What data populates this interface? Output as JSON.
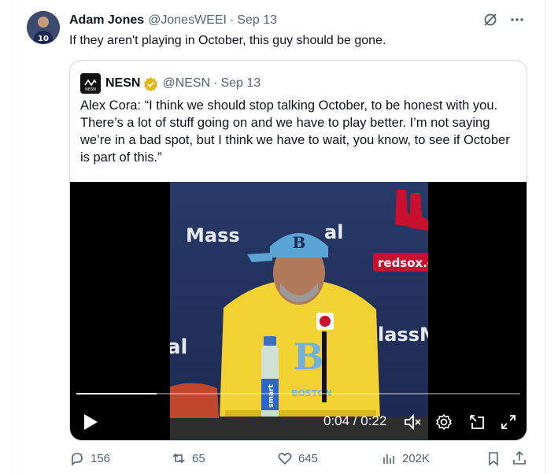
{
  "tweet": {
    "author_name": "Adam Jones",
    "author_handle": "@JonesWEEI",
    "separator": "·",
    "timestamp": "Sep 13",
    "text": "If they aren't playing in October, this guy should be gone.",
    "avatar_jersey": "10"
  },
  "quoted": {
    "author_name": "NESN",
    "author_handle": "@NESN",
    "separator": "·",
    "timestamp": "Sep 13",
    "verified": true,
    "text": "Alex Cora: “I think we should stop talking October, to be honest with you. There’s a lot of stuff going on and we have to play better. I’m not saying we’re in a bad spot, but I think we have to wait, you know, to see if October is part of this.”",
    "logo_text": "NESN",
    "video": {
      "time_display": "0:04 / 0:22",
      "progress": 0.18,
      "banner_text_left": "Mass",
      "banner_text_right": "al",
      "banner_text_low": "al",
      "banner_text_low_right": "lassM",
      "redsox_url": "redsox.c",
      "bottle_label": "smart",
      "shirt_letter": "B",
      "shirt_text": "BOSTON"
    }
  },
  "actions": {
    "replies": "156",
    "reposts": "65",
    "likes": "645",
    "views": "202K"
  },
  "colors": {
    "text_primary": "#0f1419",
    "text_secondary": "#536471",
    "border": "#cfd9de",
    "verified_gold": "#e2b719"
  }
}
